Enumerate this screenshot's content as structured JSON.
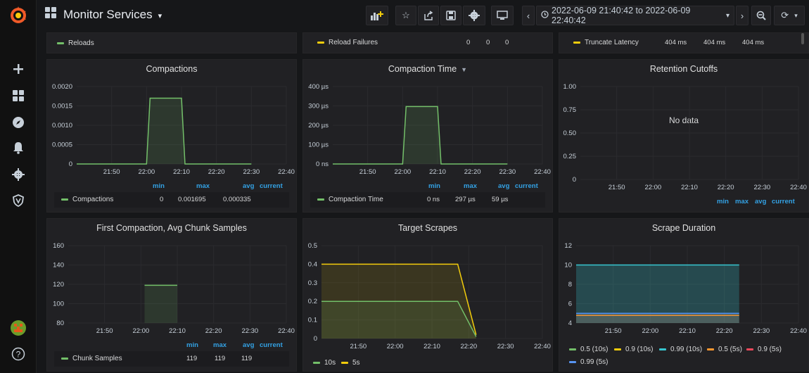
{
  "topbar": {
    "title": "Monitor Services",
    "time_range": "2022-06-09 21:40:42 to 2022-06-09 22:40:42"
  },
  "colors": {
    "green": "#73bf69",
    "yellow": "#f2cc0c",
    "cyan": "#37c6d0",
    "orange": "#ff9830",
    "red": "#f2495c",
    "blue": "#5794f2",
    "accent": "#33a2e5"
  },
  "top_row": {
    "reloads": {
      "label": "Reloads"
    },
    "reload_failures": {
      "label": "Reload Failures",
      "values": [
        "0",
        "0",
        "0"
      ]
    },
    "truncate_latency": {
      "label": "Truncate Latency",
      "values": [
        "404 ms",
        "404 ms",
        "404 ms"
      ]
    }
  },
  "legend_headers": {
    "min": "min",
    "max": "max",
    "avg": "avg",
    "current": "current"
  },
  "panels": {
    "compactions": {
      "title": "Compactions",
      "yticks": [
        "0.0020",
        "0.0015",
        "0.0010",
        "0.0005",
        "0"
      ],
      "xticks": [
        "21:50",
        "22:00",
        "22:10",
        "22:20",
        "22:30",
        "22:40"
      ],
      "legend": {
        "name": "Compactions",
        "min": "0",
        "max": "0.001695",
        "avg": "0.000335",
        "current": ""
      }
    },
    "compaction_time": {
      "title": "Compaction Time",
      "yticks": [
        "400 µs",
        "300 µs",
        "200 µs",
        "100 µs",
        "0 ns"
      ],
      "xticks": [
        "21:50",
        "22:00",
        "22:10",
        "22:20",
        "22:30",
        "22:40"
      ],
      "legend": {
        "name": "Compaction Time",
        "min": "0 ns",
        "max": "297 µs",
        "avg": "59 µs",
        "current": ""
      }
    },
    "retention_cutoffs": {
      "title": "Retention Cutoffs",
      "no_data": "No data",
      "yticks": [
        "1.00",
        "0.75",
        "0.50",
        "0.25",
        "0"
      ],
      "xticks": [
        "21:50",
        "22:00",
        "22:10",
        "22:20",
        "22:30",
        "22:40"
      ]
    },
    "first_compaction": {
      "title": "First Compaction, Avg Chunk Samples",
      "yticks": [
        "160",
        "140",
        "120",
        "100",
        "80"
      ],
      "xticks": [
        "21:50",
        "22:00",
        "22:10",
        "22:20",
        "22:30",
        "22:40"
      ],
      "legend": {
        "name": "Chunk Samples",
        "min": "119",
        "max": "119",
        "avg": "119",
        "current": ""
      }
    },
    "target_scrapes": {
      "title": "Target Scrapes",
      "yticks": [
        "0.5",
        "0.4",
        "0.3",
        "0.2",
        "0.1",
        "0"
      ],
      "xticks": [
        "21:50",
        "22:00",
        "22:10",
        "22:20",
        "22:30",
        "22:40"
      ],
      "legend": [
        "10s",
        "5s"
      ]
    },
    "scrape_duration": {
      "title": "Scrape Duration",
      "yticks": [
        "12",
        "10",
        "8",
        "6",
        "4"
      ],
      "xticks": [
        "21:50",
        "22:00",
        "22:10",
        "22:20",
        "22:30",
        "22:40"
      ],
      "legend": [
        "0.5 (10s)",
        "0.9 (10s)",
        "0.99 (10s)",
        "0.5 (5s)",
        "0.9 (5s)",
        "0.99 (5s)"
      ]
    }
  },
  "chart_data": [
    {
      "type": "line",
      "title": "Compactions",
      "x": [
        "21:40",
        "21:50",
        "22:00",
        "22:01",
        "22:10",
        "22:11",
        "22:20",
        "22:30",
        "22:40"
      ],
      "series": [
        {
          "name": "Compactions",
          "values": [
            0,
            0,
            0,
            0.0017,
            0.0017,
            0,
            0,
            0,
            null
          ]
        }
      ],
      "ylim": [
        0,
        0.002
      ]
    },
    {
      "type": "line",
      "title": "Compaction Time",
      "x": [
        "21:40",
        "21:50",
        "22:00",
        "22:01",
        "22:10",
        "22:11",
        "22:20",
        "22:30",
        "22:40"
      ],
      "series": [
        {
          "name": "Compaction Time",
          "values": [
            0,
            0,
            0,
            297,
            297,
            0,
            0,
            0,
            null
          ]
        }
      ],
      "ylim": [
        0,
        400
      ]
    },
    {
      "type": "line",
      "title": "First Compaction, Avg Chunk Samples",
      "x": [
        "22:01",
        "22:10"
      ],
      "series": [
        {
          "name": "Chunk Samples",
          "values": [
            119,
            119
          ]
        }
      ],
      "ylim": [
        80,
        160
      ]
    },
    {
      "type": "line",
      "title": "Target Scrapes",
      "x": [
        "21:40",
        "21:50",
        "22:00",
        "22:10",
        "22:17",
        "22:22"
      ],
      "series": [
        {
          "name": "10s",
          "values": [
            0.2,
            0.2,
            0.2,
            0.2,
            0.2,
            0.01
          ]
        },
        {
          "name": "5s",
          "values": [
            0.4,
            0.4,
            0.4,
            0.4,
            0.4,
            0.02
          ]
        }
      ],
      "ylim": [
        0,
        0.5
      ]
    },
    {
      "type": "area",
      "title": "Scrape Duration",
      "x": [
        "21:40",
        "21:50",
        "22:00",
        "22:10",
        "22:24"
      ],
      "series": [
        {
          "name": "0.99 (10s)",
          "values": [
            10,
            10,
            10,
            10,
            10
          ]
        },
        {
          "name": "0.99 (5s)",
          "values": [
            5,
            5,
            5,
            5,
            5
          ]
        },
        {
          "name": "0.9 (10s)",
          "values": [
            4.8,
            4.8,
            4.8,
            4.8,
            4.8
          ]
        }
      ],
      "ylim": [
        4,
        12
      ]
    }
  ]
}
